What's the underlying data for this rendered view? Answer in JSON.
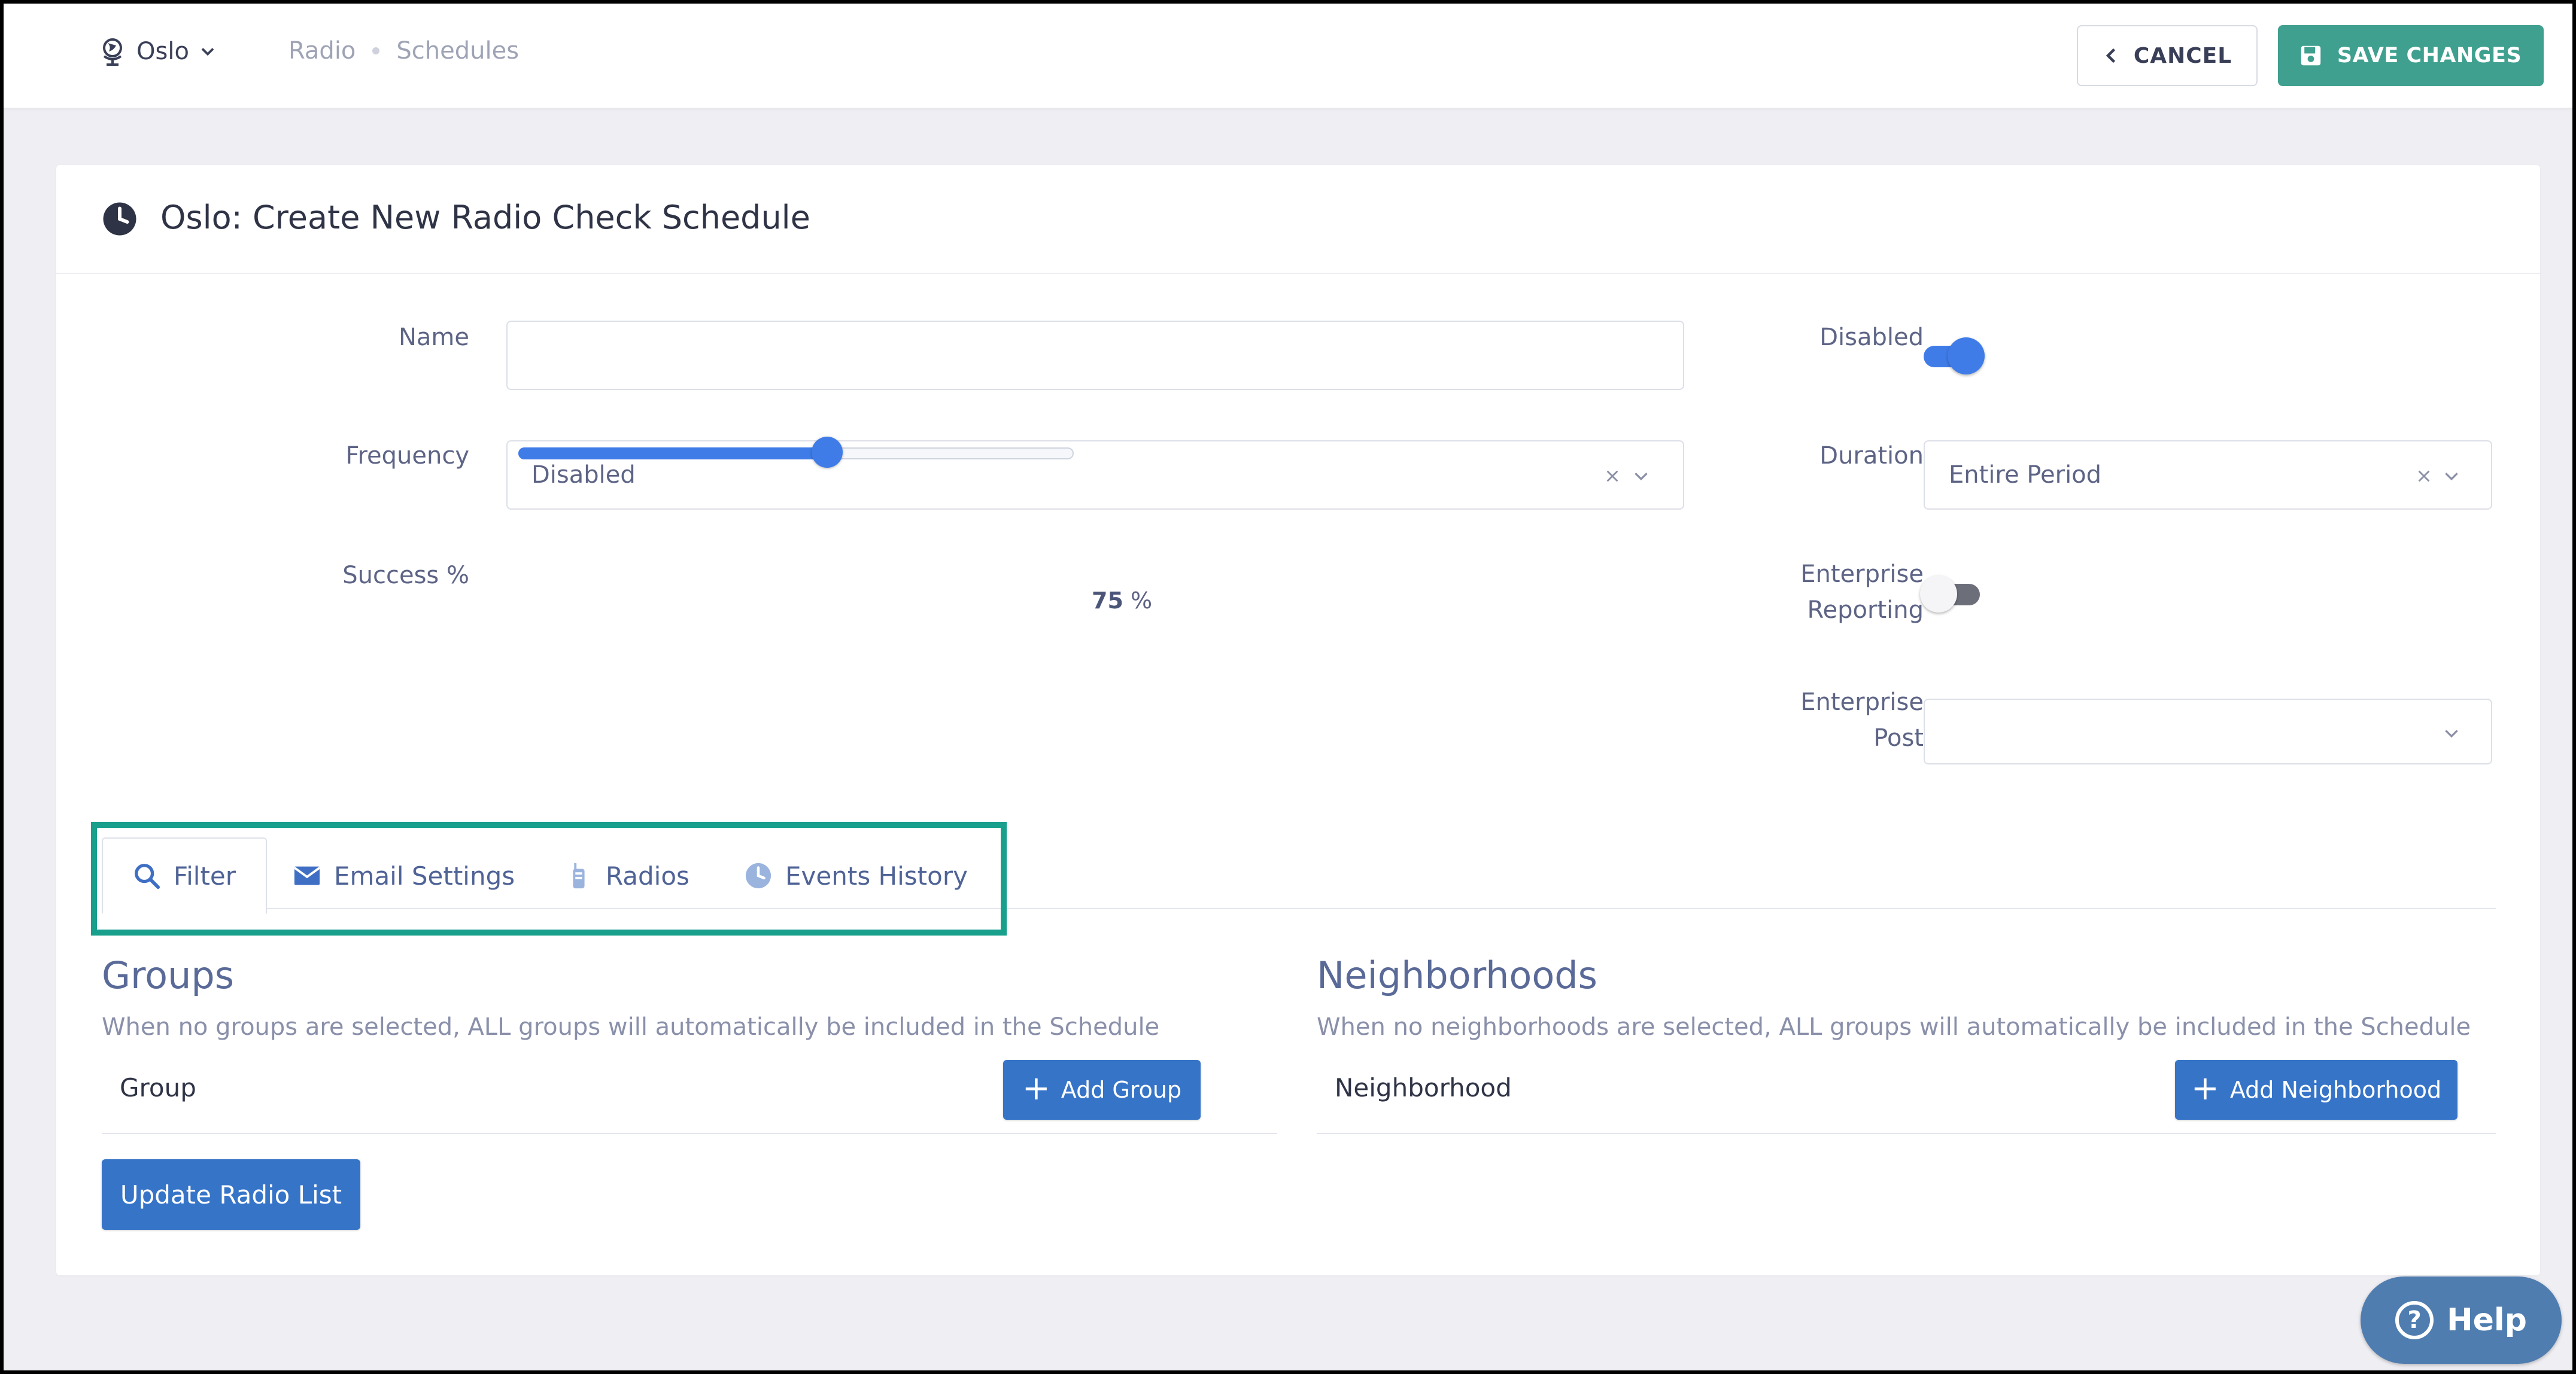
{
  "header": {
    "location": "Oslo",
    "breadcrumbs": [
      "Radio",
      "Schedules"
    ],
    "cancel_label": "CANCEL",
    "save_label": "SAVE CHANGES"
  },
  "page": {
    "title": "Oslo: Create New Radio Check Schedule"
  },
  "form": {
    "name_label": "Name",
    "name_value": "",
    "frequency_label": "Frequency",
    "frequency_value": "Disabled",
    "success_label": "Success %",
    "success_value": 75,
    "success_unit": "%",
    "disabled_label": "Disabled",
    "disabled_on": true,
    "duration_label": "Duration",
    "duration_value": "Entire Period",
    "enterprise_reporting_label_1": "Enterprise",
    "enterprise_reporting_label_2": "Reporting",
    "enterprise_reporting_on": false,
    "enterprise_post_label_1": "Enterprise",
    "enterprise_post_label_2": "Post",
    "enterprise_post_value": ""
  },
  "tabs": [
    {
      "label": "Filter",
      "icon": "search-icon",
      "active": true
    },
    {
      "label": "Email Settings",
      "icon": "envelope-icon",
      "active": false
    },
    {
      "label": "Radios",
      "icon": "radio-icon",
      "active": false
    },
    {
      "label": "Events History",
      "icon": "clock-icon",
      "active": false
    }
  ],
  "groups": {
    "title": "Groups",
    "note": "When no groups are selected, ALL groups will automatically be included in the Schedule",
    "column": "Group",
    "add_label": "Add Group"
  },
  "neighborhoods": {
    "title": "Neighborhoods",
    "note": "When no neighborhoods are selected, ALL groups will automatically be included in the Schedule",
    "column": "Neighborhood",
    "add_label": "Add Neighborhood"
  },
  "update_label": "Update Radio List",
  "help_label": "Help",
  "colors": {
    "accent_blue": "#3674c8",
    "save_green": "#3fa08f",
    "highlight_teal": "#18a08d",
    "toggle_blue": "#3f7ce8"
  }
}
